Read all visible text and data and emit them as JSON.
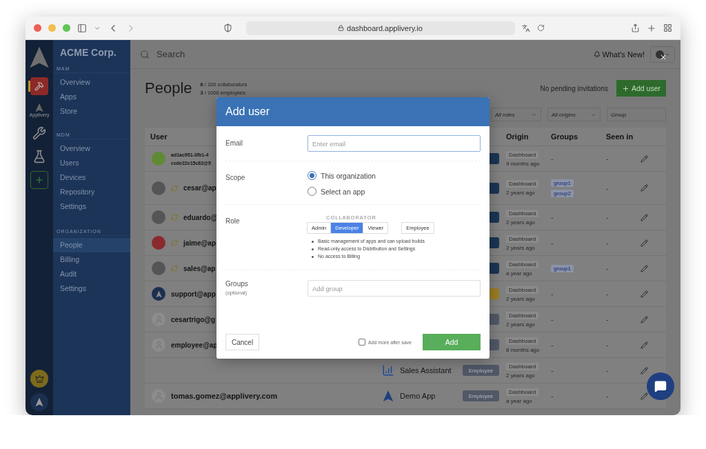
{
  "browser": {
    "url": "dashboard.applivery.io"
  },
  "rail": {
    "items": [
      {
        "kind": "app",
        "selected": true
      },
      {
        "kind": "brand",
        "label": "Applivery",
        "selected": false
      },
      {
        "kind": "tools",
        "selected": false
      },
      {
        "kind": "lab",
        "selected": false
      },
      {
        "kind": "add",
        "selected": false
      }
    ],
    "bottom": [
      {
        "kind": "crown"
      },
      {
        "kind": "logo"
      }
    ]
  },
  "sidebar": {
    "org": "ACME Corp.",
    "sections": [
      {
        "title": "MAM",
        "items": [
          {
            "label": "Overview",
            "selected": false
          },
          {
            "label": "Apps",
            "selected": false
          },
          {
            "label": "Store",
            "selected": false
          }
        ]
      },
      {
        "title": "MDM",
        "items": [
          {
            "label": "Overview",
            "selected": false
          },
          {
            "label": "Users",
            "selected": false
          },
          {
            "label": "Devices",
            "selected": false
          },
          {
            "label": "Repository",
            "selected": false
          },
          {
            "label": "Settings",
            "selected": false
          }
        ]
      },
      {
        "title": "ORGANIZATION",
        "items": [
          {
            "label": "People",
            "selected": true
          },
          {
            "label": "Billing",
            "selected": false
          },
          {
            "label": "Audit",
            "selected": false
          },
          {
            "label": "Settings",
            "selected": false
          }
        ]
      }
    ]
  },
  "topbar": {
    "search_placeholder": "Search",
    "whats_new": "What's New!"
  },
  "page": {
    "title": "People",
    "stats": [
      "**6** / 100 collaborators",
      "**3** / 1000 employees"
    ],
    "invitations": "No pending invitations",
    "add_button": "Add user"
  },
  "filters": [
    {
      "kind": "select",
      "value": "All roles"
    },
    {
      "kind": "select",
      "value": "All origins"
    },
    {
      "kind": "input",
      "placeholder": "Group"
    }
  ],
  "table": {
    "columns": [
      "User",
      "Origin",
      "Groups",
      "Seen in"
    ],
    "rows": [
      {
        "avatar": {
          "kind": "solid",
          "color": "#5f8a33"
        },
        "user": "ad1ac951-3fb1-4",
        "user_line2": "cede22e15c82@5",
        "owner": false,
        "role": {
          "color": "#1b3554"
        },
        "origin": "Dashboard",
        "origin_time": "9 months ago",
        "groups": "-",
        "seen_in": "-"
      },
      {
        "avatar": {
          "kind": "photo"
        },
        "user": "cesar@ap",
        "owner": true,
        "role": {
          "color": "#1b3554"
        },
        "origin": "Dashboard",
        "origin_time": "2 years ago",
        "groups": [
          "group1",
          "group2"
        ],
        "seen_in": "-"
      },
      {
        "avatar": {
          "kind": "photo"
        },
        "user": "eduardo@",
        "owner": true,
        "role": {
          "color": "#1b3554"
        },
        "origin": "Dashboard",
        "origin_time": "2 years ago",
        "groups": "-",
        "seen_in": "-"
      },
      {
        "avatar": {
          "kind": "solid",
          "color": "#8a2a2c"
        },
        "user": "jaime@ap",
        "owner": true,
        "role": {
          "color": "#1b3554"
        },
        "origin": "Dashboard",
        "origin_time": "2 years ago",
        "groups": "-",
        "seen_in": "-"
      },
      {
        "avatar": {
          "kind": "photo"
        },
        "user": "sales@ap",
        "owner": true,
        "role": {
          "color": "#1b3554"
        },
        "origin": "Dashboard",
        "origin_time": "a year ago",
        "groups": [
          "group1"
        ],
        "seen_in": "-"
      },
      {
        "avatar": {
          "kind": "logo"
        },
        "user": "support@app",
        "owner": false,
        "role": {
          "color": "#9a7c22"
        },
        "origin": "Dashboard",
        "origin_time": "2 years ago",
        "groups": "-",
        "seen_in": "-"
      },
      {
        "avatar": {
          "kind": "default"
        },
        "user": "cesartrigo@g",
        "owner": false,
        "role": {
          "color": "#505866"
        },
        "origin": "Dashboard",
        "origin_time": "2 years ago",
        "groups": "-",
        "seen_in": "-"
      },
      {
        "avatar": {
          "kind": "default"
        },
        "user": "employee@ap",
        "owner": false,
        "role": {
          "color": "#505866"
        },
        "origin": "Dashboard",
        "origin_time": "8 months ago",
        "groups": "-",
        "seen_in": "-"
      },
      {
        "app": {
          "kind": "chart",
          "name": "Sales Assistant"
        },
        "role": {
          "color": "#505866",
          "label": "Employee"
        },
        "origin": "Dashboard",
        "origin_time": "2 years ago",
        "groups": "-",
        "seen_in": "-"
      },
      {
        "avatar": {
          "kind": "default"
        },
        "user": "tomas.gomez@applivery.com",
        "owner": false,
        "app": {
          "kind": "logo",
          "name": "Demo App"
        },
        "role": {
          "color": "#505866",
          "label": "Employee"
        },
        "origin": "Dashboard",
        "origin_time": "a year ago",
        "groups": "-",
        "seen_in": "-"
      }
    ]
  },
  "modal": {
    "title": "Add user",
    "email": {
      "label": "Email",
      "placeholder": "Enter email",
      "focused": true
    },
    "scope": {
      "label": "Scope",
      "options": [
        {
          "label": "This organization",
          "selected": true
        },
        {
          "label": "Select an app",
          "selected": false
        }
      ]
    },
    "role": {
      "label": "Role",
      "group_title": "COLLABORATOR",
      "options": [
        {
          "label": "Admin",
          "kind": "collaborator",
          "selected": false
        },
        {
          "label": "Developer",
          "kind": "collaborator",
          "selected": true
        },
        {
          "label": "Viewer",
          "kind": "collaborator",
          "selected": false
        },
        {
          "label": "Employee",
          "kind": "employee",
          "selected": false
        }
      ],
      "permissions": [
        "Basic management of apps and can upload builds",
        "Read-only access to Distribution and Settings",
        "No access to Billing"
      ]
    },
    "groups": {
      "label": "Groups",
      "hint": "(optional)",
      "placeholder": "Add group"
    },
    "cancel": "Cancel",
    "add_more": {
      "label": "Add more after save",
      "checked": false
    },
    "submit": "Add"
  }
}
